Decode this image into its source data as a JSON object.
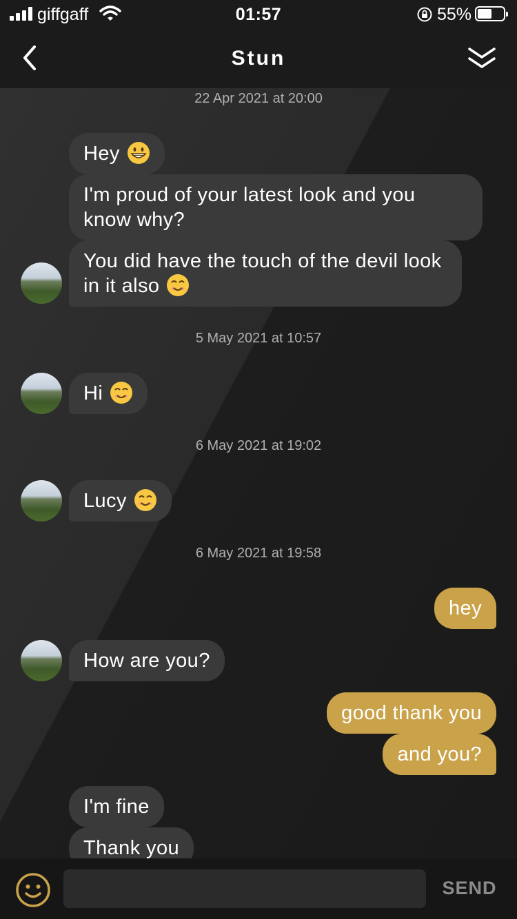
{
  "status_bar": {
    "carrier": "giffgaff",
    "time": "01:57",
    "battery_percent": "55%",
    "battery_level": 0.55
  },
  "nav": {
    "title": "Stun",
    "back_icon": "chevron-left-icon",
    "collapse_icon": "double-chevron-down-icon"
  },
  "chat": {
    "timestamps": [
      "22 Apr 2021 at 20:00",
      "5 May 2021 at 10:57",
      "6 May 2021 at 19:02",
      "6 May 2021 at 19:58"
    ],
    "messages": [
      {
        "from": "them",
        "text": "Hey",
        "emoji": "grinning-face"
      },
      {
        "from": "them",
        "text": "I'm proud of your latest look and you know why?"
      },
      {
        "from": "them",
        "text": "You did have the touch of the devil look in it also",
        "emoji": "smiling-face"
      },
      {
        "from": "them",
        "text": "Hi",
        "emoji": "smiling-face"
      },
      {
        "from": "them",
        "text": "Lucy",
        "emoji": "smiling-face"
      },
      {
        "from": "me",
        "text": "hey"
      },
      {
        "from": "them",
        "text": "How are you?"
      },
      {
        "from": "me",
        "text": "good thank you"
      },
      {
        "from": "me",
        "text": "and you?"
      },
      {
        "from": "them",
        "text": "I'm fine"
      },
      {
        "from": "them",
        "text": "Thank you"
      }
    ]
  },
  "composer": {
    "input_value": "",
    "send_label": "SEND",
    "emoji_icon": "smiley-icon"
  },
  "colors": {
    "accent": "#c9a24a",
    "incoming_bubble": "#3a3a3a",
    "background": "#1c1c1c"
  }
}
